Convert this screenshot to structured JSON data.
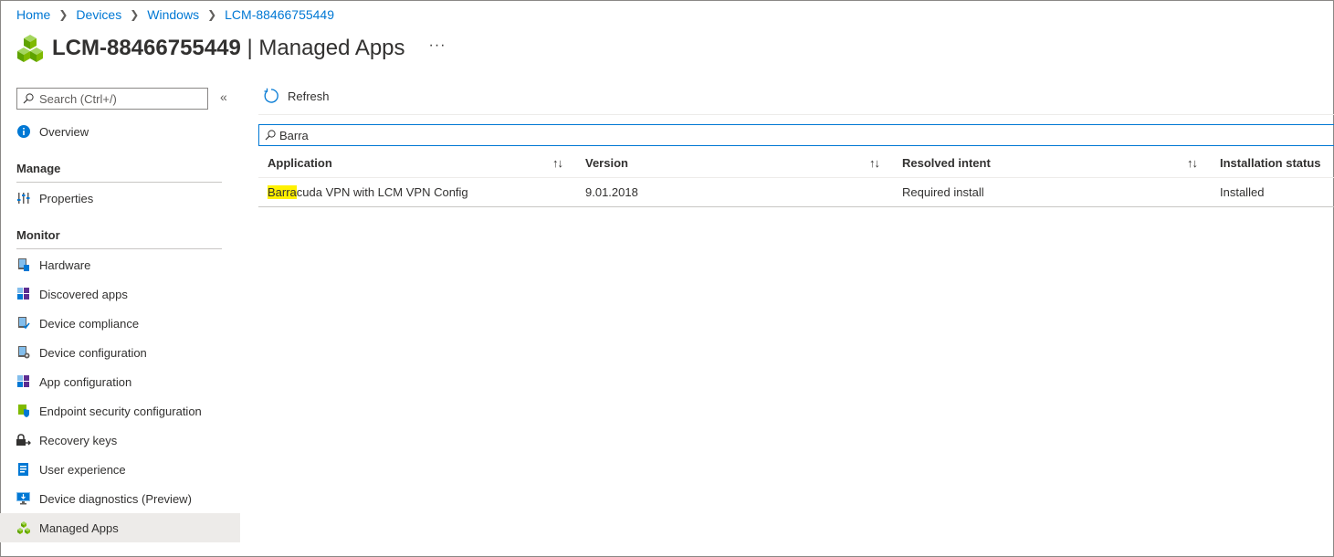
{
  "breadcrumb": {
    "items": [
      "Home",
      "Devices",
      "Windows",
      "LCM-88466755449"
    ]
  },
  "header": {
    "device_name": "LCM-88466755449",
    "separator": "|",
    "blade_name": "Managed Apps",
    "more_label": "···"
  },
  "sidebar": {
    "search_placeholder": "Search (Ctrl+/)",
    "collapse_label": "«",
    "overview": "Overview",
    "manage_title": "Manage",
    "manage_items": [
      "Properties"
    ],
    "monitor_title": "Monitor",
    "monitor_items": [
      {
        "label": "Hardware",
        "icon": "hardware-icon"
      },
      {
        "label": "Discovered apps",
        "icon": "discovered-apps-icon"
      },
      {
        "label": "Device compliance",
        "icon": "device-compliance-icon"
      },
      {
        "label": "Device configuration",
        "icon": "device-configuration-icon"
      },
      {
        "label": "App configuration",
        "icon": "app-configuration-icon"
      },
      {
        "label": "Endpoint security configuration",
        "icon": "endpoint-security-icon"
      },
      {
        "label": "Recovery keys",
        "icon": "recovery-keys-icon"
      },
      {
        "label": "User experience",
        "icon": "user-experience-icon"
      },
      {
        "label": "Device diagnostics (Preview)",
        "icon": "device-diagnostics-icon"
      },
      {
        "label": "Managed Apps",
        "icon": "managed-apps-icon"
      }
    ],
    "active_item": "Managed Apps"
  },
  "toolbar": {
    "refresh_label": "Refresh"
  },
  "filter": {
    "value": "Barra"
  },
  "table": {
    "columns": [
      "Application",
      "Version",
      "Resolved intent",
      "Installation status"
    ],
    "sort_glyph": "↑↓",
    "rows": [
      {
        "application_match": "Barra",
        "application_rest": "cuda VPN with LCM VPN Config",
        "version": "9.01.2018",
        "resolved_intent": "Required install",
        "installation_status": "Installed"
      }
    ]
  },
  "colors": {
    "link": "#0078d4",
    "highlight": "#fff100",
    "active_nav": "#edebe9",
    "text": "#323130"
  }
}
